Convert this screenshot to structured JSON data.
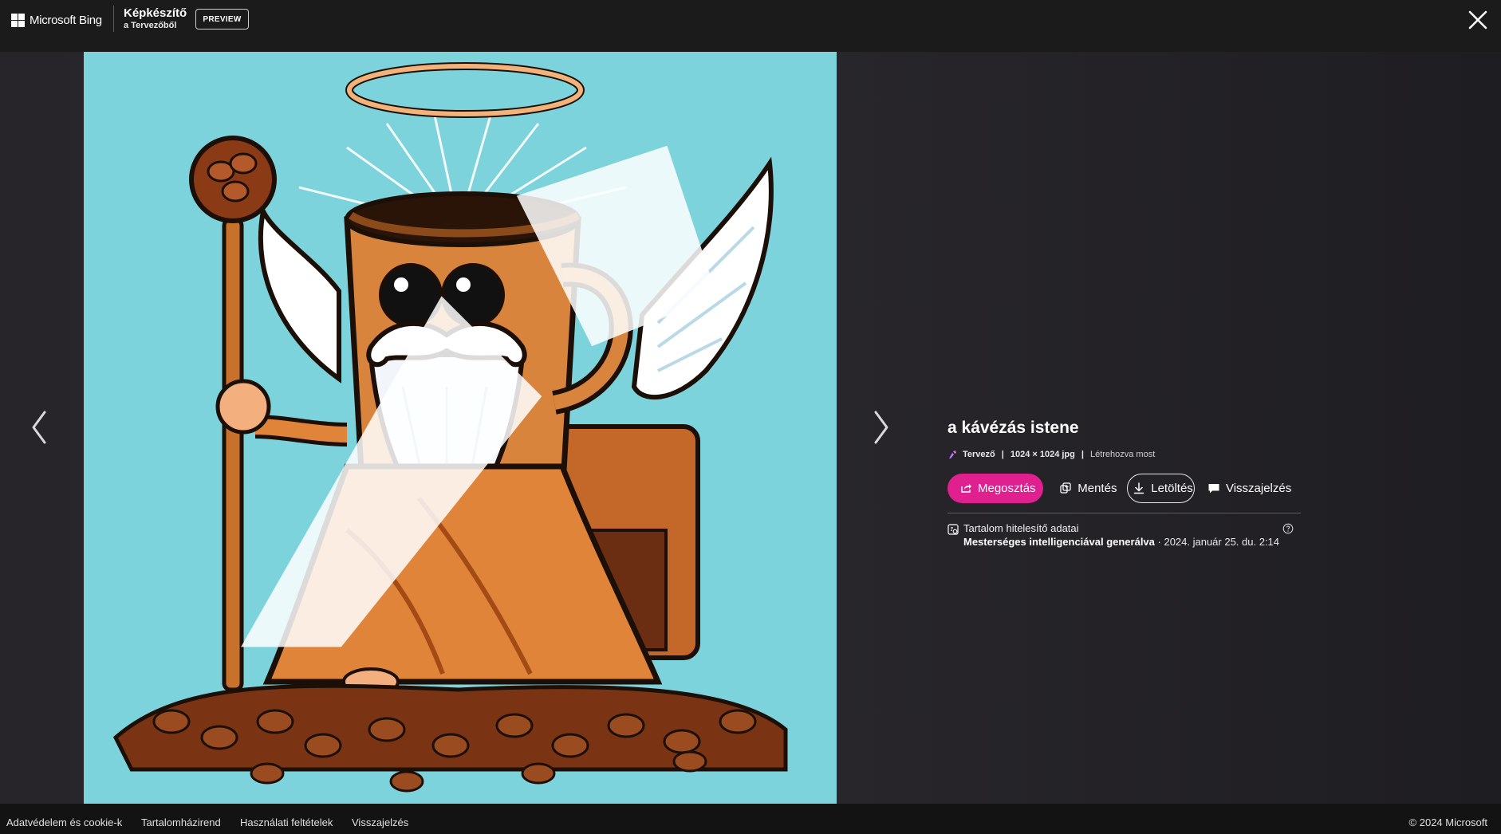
{
  "header": {
    "brand_name": "Microsoft Bing",
    "product_title": "Képkészítő",
    "product_subtitle": "a Tervezőből",
    "preview_label": "PREVIEW"
  },
  "image": {
    "title": "a kávézás istene",
    "designer_label": "Tervező",
    "dimensions": "1024 × 1024 jpg",
    "created": "Létrehozva most"
  },
  "actions": {
    "share_label": "Megosztás",
    "save_label": "Mentés",
    "download_label": "Letöltés",
    "feedback_label": "Visszajelzés"
  },
  "credentials": {
    "title": "Tartalom hitelesítő adatai",
    "generated_label": "Mesterséges intelligenciával generálva",
    "date": " · 2024. január 25. du. 2:14"
  },
  "footer": {
    "links": [
      "Adatvédelem és cookie-k",
      "Tartalomházirend",
      "Használati feltételek",
      "Visszajelzés"
    ],
    "copyright": "© 2024 Microsoft"
  },
  "colors": {
    "share_button": "#e0208e",
    "image_background": "#7ed3dc",
    "page_background": "#1e1d20"
  },
  "icons": [
    "ms-logo-icon",
    "close-icon",
    "chevron-left-icon",
    "chevron-right-icon",
    "designer-icon",
    "share-icon",
    "save-icon",
    "download-icon",
    "feedback-icon",
    "content-credentials-icon",
    "help-icon"
  ]
}
